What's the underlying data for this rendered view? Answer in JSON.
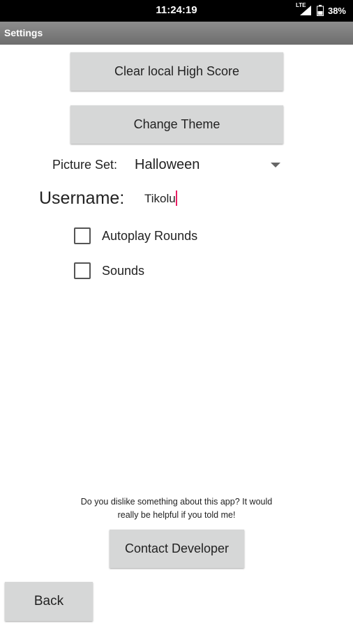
{
  "status_bar": {
    "time": "11:24:19",
    "network": "LTE",
    "battery": "38%"
  },
  "app_bar": {
    "title": "Settings"
  },
  "buttons": {
    "clear_high_score": "Clear local High Score",
    "change_theme": "Change Theme",
    "contact_developer": "Contact Developer",
    "back": "Back"
  },
  "picture_set": {
    "label": "Picture Set:",
    "selected": "Halloween"
  },
  "username": {
    "label": "Username:",
    "value": "Tikolu"
  },
  "checkboxes": [
    {
      "label": "Autoplay Rounds",
      "checked": false
    },
    {
      "label": "Sounds",
      "checked": false
    }
  ],
  "feedback": {
    "message": "Do you dislike something about this app? It would really be helpful if you told me!"
  },
  "colors": {
    "status_bar": "#000000",
    "app_bar": "#7d7d7d",
    "button": "#d6d7d7",
    "caret": "#e91e63"
  }
}
